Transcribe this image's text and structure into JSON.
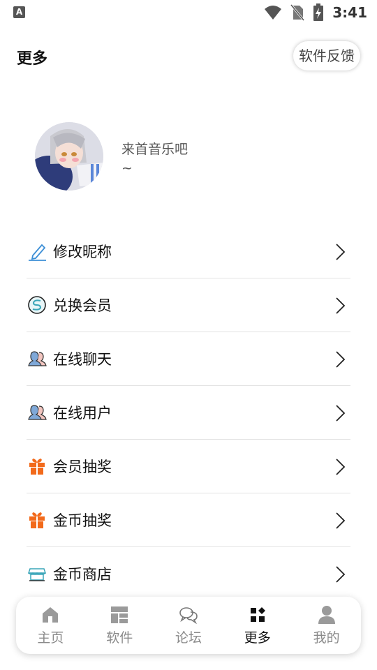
{
  "status": {
    "notification_letter": "A",
    "time": "3:41"
  },
  "header": {
    "title": "更多",
    "feedback_label": "软件反馈"
  },
  "profile": {
    "name": "来首音乐吧",
    "signature": "~"
  },
  "menu": [
    {
      "label": "修改昵称",
      "icon": "edit-icon"
    },
    {
      "label": "兑换会员",
      "icon": "redeem-icon"
    },
    {
      "label": "在线聊天",
      "icon": "users-icon"
    },
    {
      "label": "在线用户",
      "icon": "users-icon"
    },
    {
      "label": "会员抽奖",
      "icon": "gift-icon"
    },
    {
      "label": "金币抽奖",
      "icon": "gift-icon"
    },
    {
      "label": "金币商店",
      "icon": "shop-icon"
    }
  ],
  "bottom_nav": [
    {
      "label": "主页",
      "icon": "home-icon",
      "active": false
    },
    {
      "label": "软件",
      "icon": "apps-icon",
      "active": false
    },
    {
      "label": "论坛",
      "icon": "forum-icon",
      "active": false
    },
    {
      "label": "更多",
      "icon": "more-icon",
      "active": true
    },
    {
      "label": "我的",
      "icon": "profile-icon",
      "active": false
    }
  ],
  "colors": {
    "gift": "#f26a1b",
    "edit": "#3d8fd6",
    "nav_inactive": "#9a9a9a",
    "nav_active": "#111111"
  }
}
